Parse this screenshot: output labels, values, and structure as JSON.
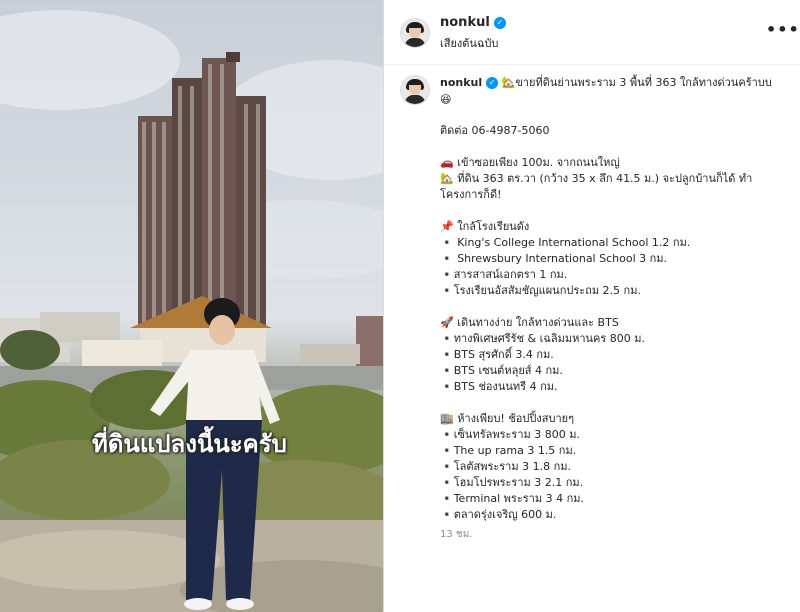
{
  "media": {
    "overlay_caption": "ที่ดินแปลงนี้นะครับ"
  },
  "header": {
    "username": "nonkul",
    "subtitle": "เสียงต้นฉบับ",
    "more_label": "•••"
  },
  "post": {
    "username": "nonkul",
    "caption_lines": [
      "🏡ขายที่ดินย่านพระราม 3 พื้นที่ 363 ใกล้ทางด่วนคร้าบบ",
      "😆",
      "ติดต่อ 06-4987-5060",
      "🚗 เข้าซอยเพียง 100ม. จากถนนใหญ่",
      "🏡 ที่ดิน 363 ตร.วา (กว้าง 35 x ลึก 41.5 ม.) จะปลูกบ้านก็ได้ ทำ",
      "โครงการก็ดี!",
      "📌 ใกล้โรงเรียนดัง",
      "▪️ King's College International School 1.2 กม.",
      "▪️ Shrewsbury International School 3 กม.",
      "▪️สารสาสน์เอกตรา 1 กม.",
      "▪️โรงเรียนอัสสัมชัญแผนกประถม 2.5 กม.",
      "🚀 เดินทางง่าย ใกล้ทางด่วนและ BTS",
      "▪️ทางพิเศษศรีรัช & เฉลิมมหานคร 800 ม.",
      "▪️BTS สุรศักดิ์ 3.4 กม.",
      "▪️BTS เซนต์หลุยส์ 4 กม.",
      "▪️BTS ช่องนนทรี 4 กม.",
      "🏬 ห้างเพียบ! ช้อปปิ้งสบายๆ",
      "▪️เซ็นทรัลพระราม 3 800 ม.",
      "▪️The up rama 3 1.5 กม.",
      "▪️โลตัสพระราม 3 1.8 กม.",
      "▪️โฮมโปรพระราม 3 2.1 กม.",
      "▪️Terminal พระราม 3 4 กม.",
      "▪️ตลาดรุ่งเจริญ 600 ม."
    ],
    "time_ago": "13 ชม."
  },
  "colors": {
    "verified": "#0095f6",
    "text": "#262626",
    "muted": "#8e8e8e"
  }
}
